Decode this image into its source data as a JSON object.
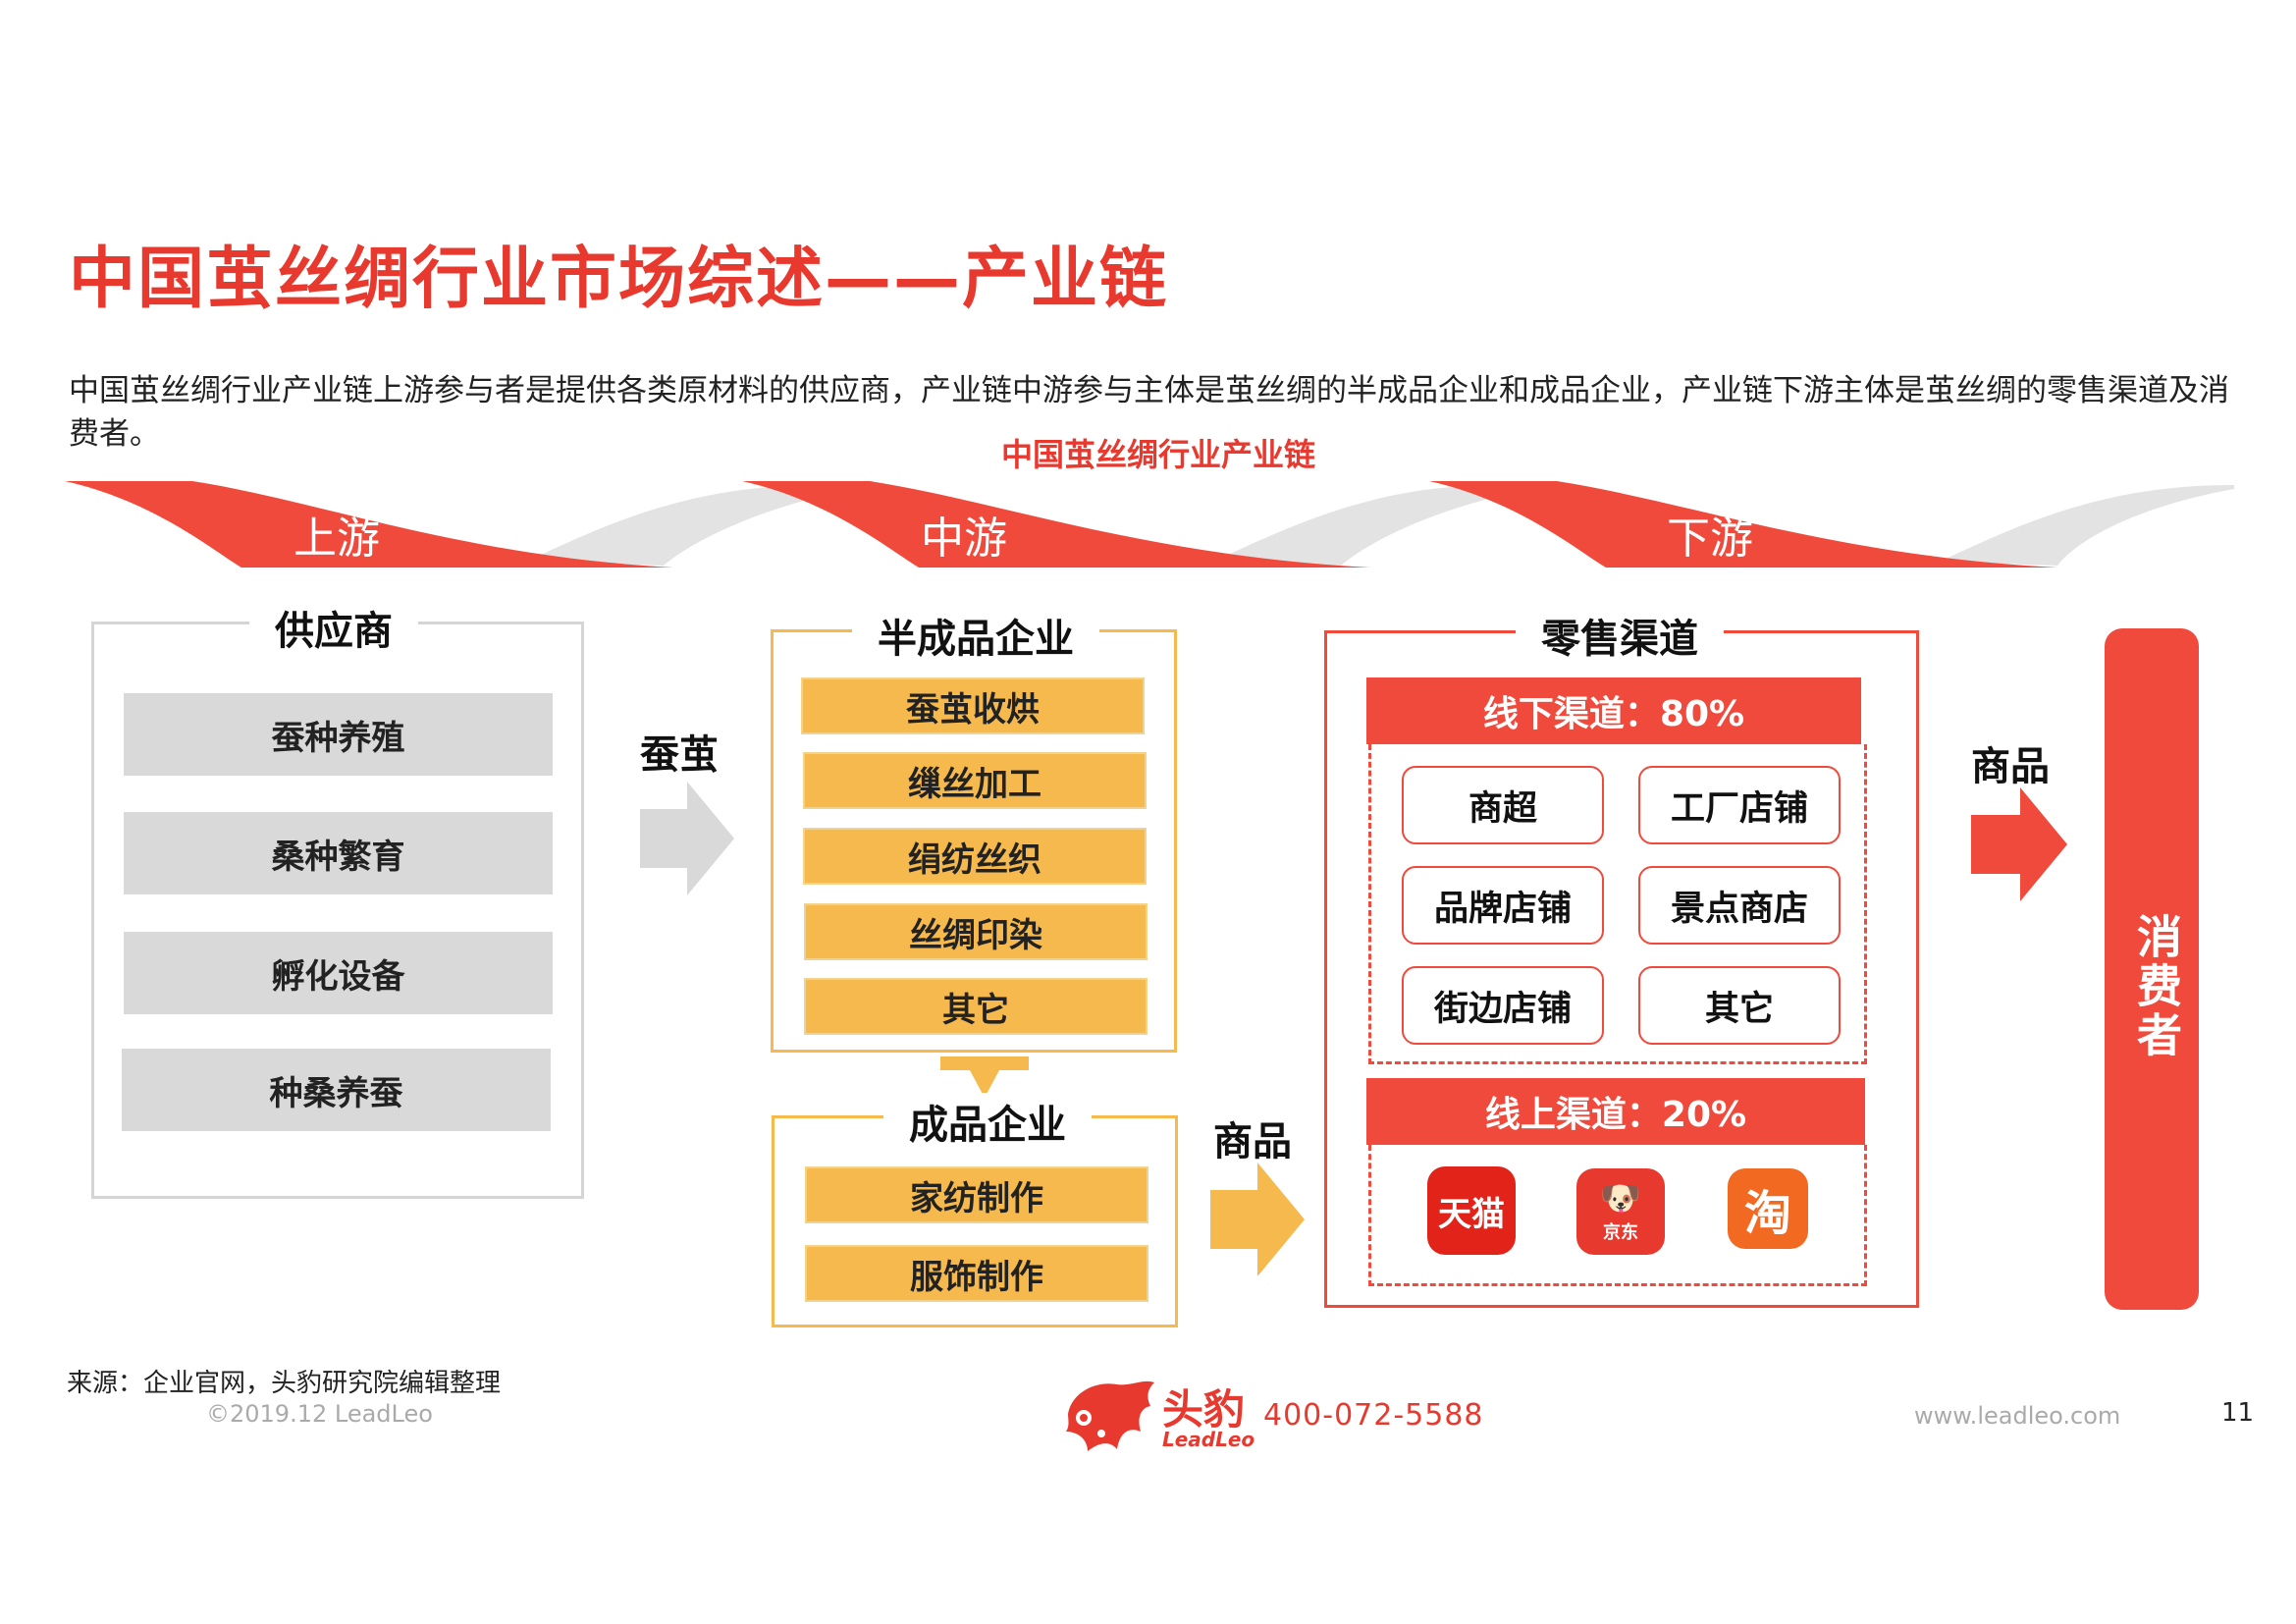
{
  "title": "中国茧丝绸行业市场综述——产业链",
  "intro": "中国茧丝绸行业产业链上游参与者是提供各类原材料的供应商，产业链中游参与主体是茧丝绸的半成品企业和成品企业，产业链下游主体是茧丝绸的零售渠道及消费者。",
  "subtitle": "中国茧丝绸行业产业链",
  "stages": {
    "up": "上游",
    "mid": "中游",
    "down": "下游"
  },
  "supplier": {
    "title": "供应商",
    "items": [
      "蚕种养殖",
      "桑种繁育",
      "孵化设备",
      "种桑养蚕"
    ]
  },
  "semi": {
    "title": "半成品企业",
    "items": [
      "蚕茧收烘",
      "缫丝加工",
      "绢纺丝织",
      "丝绸印染",
      "其它"
    ]
  },
  "finished": {
    "title": "成品企业",
    "items": [
      "家纺制作",
      "服饰制作"
    ]
  },
  "flow": {
    "cocoon": "蚕茧",
    "goods1": "商品",
    "goods2": "商品"
  },
  "retail": {
    "title": "零售渠道",
    "offline_label": "线下渠道：80%",
    "offline": [
      "商超",
      "工厂店铺",
      "品牌店铺",
      "景点商店",
      "街边店铺",
      "其它"
    ],
    "online_label": "线上渠道：20%",
    "apps": {
      "tmall": "天猫",
      "jd": "京东",
      "taobao": "淘"
    }
  },
  "consumer": "消费者",
  "footer": {
    "source": "来源：企业官网，头豹研究院编辑整理",
    "copyright": "©2019.12 LeadLeo",
    "brand_cn": "头豹",
    "brand_en": "LeadLeo",
    "phone": "400-072-5588",
    "website": "www.leadleo.com",
    "page": "11"
  },
  "colors": {
    "accent": "#e8392f",
    "yellow": "#f6b94d",
    "gray": "#d9d9d9"
  }
}
